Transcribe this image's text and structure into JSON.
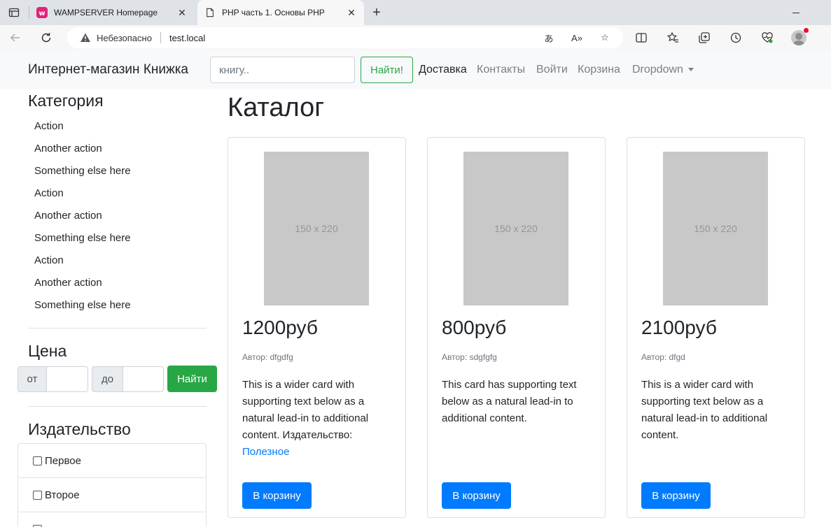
{
  "browser": {
    "tabs": [
      {
        "title": "WAMPSERVER Homepage",
        "active": false
      },
      {
        "title": "PHP часть 1. Основы PHP",
        "active": true
      }
    ],
    "address": {
      "security_label": "Небезопасно",
      "url": "test.local"
    },
    "icons": [
      "tab-actions-icon",
      "back-icon",
      "reload-icon",
      "warning-icon",
      "translate-icon",
      "read-aloud-icon",
      "favorite-icon",
      "split-screen-icon",
      "favorites-icon",
      "collections-icon",
      "history-icon",
      "health-icon",
      "profile-avatar"
    ]
  },
  "navbar": {
    "brand": "Интернет-магазин Книжка",
    "search_placeholder": "книгу..",
    "search_button": "Найти!",
    "links": [
      {
        "label": "Доставка",
        "active": true
      },
      {
        "label": "Контакты",
        "active": false
      },
      {
        "label": "Войти",
        "active": false
      },
      {
        "label": "Корзина",
        "active": false
      },
      {
        "label": "Dropdown",
        "active": false
      }
    ]
  },
  "sidebar": {
    "category_heading": "Категория",
    "categories": [
      "Action",
      "Another action",
      "Something else here",
      "Action",
      "Another action",
      "Something else here",
      "Action",
      "Another action",
      "Something else here"
    ],
    "price_heading": "Цена",
    "price_from_label": "от",
    "price_to_label": "до",
    "price_button": "Найти",
    "publisher_heading": "Издательство",
    "publishers": [
      "Первое",
      "Второе"
    ]
  },
  "main": {
    "title": "Каталог",
    "cards": [
      {
        "image_label": "150 x 220",
        "price": "1200руб",
        "author": "Автор: dfgdfg",
        "text": "This is a wider card with supporting text below as a natural lead-in to additional content. Издательство:",
        "link": "Полезное",
        "button": "В корзину"
      },
      {
        "image_label": "150 x 220",
        "price": "800руб",
        "author": "Автор: sdgfgfg",
        "text": "This card has supporting text below as a natural lead-in to additional content.",
        "link": "",
        "button": "В корзину"
      },
      {
        "image_label": "150 x 220",
        "price": "2100руб",
        "author": "Автор: dfgd",
        "text": "This is a wider card with supporting text below as a natural lead-in to additional content.",
        "link": "",
        "button": "В корзину"
      }
    ]
  },
  "colors": {
    "primary": "#007bff",
    "success": "#28a745",
    "navbar_bg": "#f8f9fa",
    "placeholder_img": "#c8c8c8"
  }
}
